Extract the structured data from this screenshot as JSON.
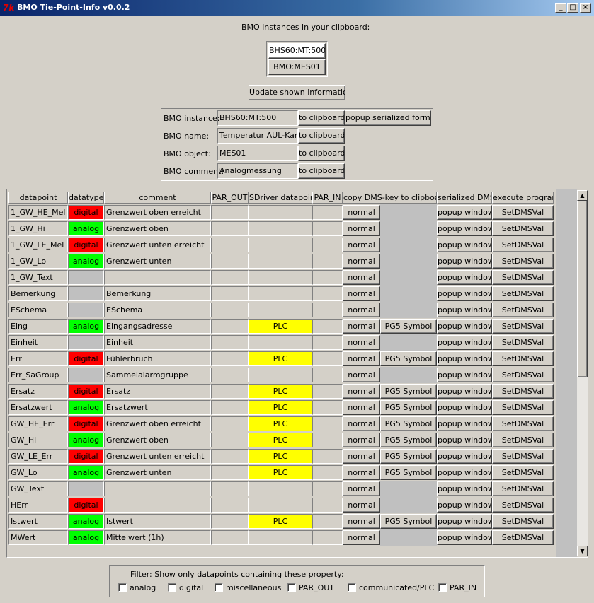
{
  "window": {
    "title": "BMO Tie-Point-Info v0.0.2",
    "app_icon": "tk-icon"
  },
  "clipboard": {
    "heading": "BMO instances in your clipboard:",
    "instances": [
      "BHS60:MT:500",
      "BMO:MES01"
    ],
    "update_label": "Update shown information"
  },
  "info": {
    "instance_label": "BMO instance:",
    "instance_value": "BHS60:MT:500",
    "name_label": "BMO name:",
    "name_value": "Temperatur AUL-Kanal",
    "object_label": "BMO object:",
    "object_value": "MES01",
    "comment_label": "BMO comment:",
    "comment_value": "Analogmessung",
    "to_clipboard_label": "to clipboard",
    "popup_serialized_label": "popup serialized format"
  },
  "table": {
    "headers": [
      "datapoint",
      "datatype",
      "comment",
      "PAR_OUT",
      "SDriver datapoint",
      "PAR_IN",
      "copy DMS-key to clipboard",
      "serialized DMS",
      "execute program"
    ],
    "copy_label": "normal",
    "popup_label": "popup window",
    "exec_label": "SetDMSVal",
    "pg5_label": "PG5 Symbol",
    "rows": [
      {
        "dp": "1_GW_HE_Mel",
        "type": "digital",
        "comment": "Grenzwert oben erreicht",
        "sdriver": "",
        "pg5": false
      },
      {
        "dp": "1_GW_Hi",
        "type": "analog",
        "comment": "Grenzwert oben",
        "sdriver": "",
        "pg5": false
      },
      {
        "dp": "1_GW_LE_Mel",
        "type": "digital",
        "comment": "Grenzwert unten erreicht",
        "sdriver": "",
        "pg5": false
      },
      {
        "dp": "1_GW_Lo",
        "type": "analog",
        "comment": "Grenzwert unten",
        "sdriver": "",
        "pg5": false
      },
      {
        "dp": "1_GW_Text",
        "type": "",
        "comment": "",
        "sdriver": "",
        "pg5": false
      },
      {
        "dp": "Bemerkung",
        "type": "",
        "comment": "Bemerkung",
        "sdriver": "",
        "pg5": false
      },
      {
        "dp": "ESchema",
        "type": "",
        "comment": "ESchema",
        "sdriver": "",
        "pg5": false
      },
      {
        "dp": "Eing",
        "type": "analog",
        "comment": "Eingangsadresse",
        "sdriver": "PLC",
        "pg5": true
      },
      {
        "dp": "Einheit",
        "type": "",
        "comment": "Einheit",
        "sdriver": "",
        "pg5": false
      },
      {
        "dp": "Err",
        "type": "digital",
        "comment": "Fühlerbruch",
        "sdriver": "PLC",
        "pg5": true
      },
      {
        "dp": "Err_SaGroup",
        "type": "",
        "comment": "Sammelalarmgruppe",
        "sdriver": "",
        "pg5": false
      },
      {
        "dp": "Ersatz",
        "type": "digital",
        "comment": "Ersatz",
        "sdriver": "PLC",
        "pg5": true
      },
      {
        "dp": "Ersatzwert",
        "type": "analog",
        "comment": "Ersatzwert",
        "sdriver": "PLC",
        "pg5": true
      },
      {
        "dp": "GW_HE_Err",
        "type": "digital",
        "comment": "Grenzwert oben erreicht",
        "sdriver": "PLC",
        "pg5": true
      },
      {
        "dp": "GW_Hi",
        "type": "analog",
        "comment": "Grenzwert oben",
        "sdriver": "PLC",
        "pg5": true
      },
      {
        "dp": "GW_LE_Err",
        "type": "digital",
        "comment": "Grenzwert unten erreicht",
        "sdriver": "PLC",
        "pg5": true
      },
      {
        "dp": "GW_Lo",
        "type": "analog",
        "comment": "Grenzwert unten",
        "sdriver": "PLC",
        "pg5": true
      },
      {
        "dp": "GW_Text",
        "type": "",
        "comment": "",
        "sdriver": "",
        "pg5": false
      },
      {
        "dp": "HErr",
        "type": "digital",
        "comment": "",
        "sdriver": "",
        "pg5": false
      },
      {
        "dp": "Istwert",
        "type": "analog",
        "comment": "Istwert",
        "sdriver": "PLC",
        "pg5": true
      },
      {
        "dp": "MWert",
        "type": "analog",
        "comment": "Mittelwert (1h)",
        "sdriver": "",
        "pg5": false
      }
    ]
  },
  "filter": {
    "heading": "Filter: Show only datapoints containing these property:",
    "options": [
      "analog",
      "digital",
      "miscellaneous",
      "PAR_OUT",
      "communicated/PLC",
      "PAR_IN"
    ]
  },
  "colors": {
    "digital": "#ff0000",
    "analog": "#00ff00",
    "plc": "#ffff00",
    "empty": "#c0c0c0",
    "titlebar": "#0a246a"
  }
}
